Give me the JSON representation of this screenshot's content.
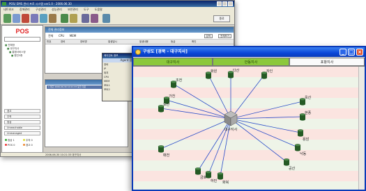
{
  "back_window": {
    "title": "POS/ EMS 관리 프로 시스템 ver1.0 - 2006.06.30",
    "menu": [
      "네트워크",
      "장애관리",
      "구성관리",
      "성능관리",
      "보안관리",
      "도구",
      "도움말"
    ],
    "exit_label": "종료",
    "logo": "POS",
    "tree": [
      "전체망",
      "대구지사",
      "통합서비스망",
      "원천3층"
    ],
    "status_rows": [
      "경고",
      "주의",
      "정상",
      "Unreachable",
      "Unmanaged"
    ],
    "legend": [
      {
        "label": "정상 1",
        "color": "#3a3"
      },
      {
        "label": "주의 0",
        "color": "#dd3"
      },
      {
        "label": "POS 0",
        "color": "#e33"
      },
      {
        "label": "경고 0",
        "color": "#e83"
      }
    ],
    "main_panel": {
      "title": "전체 관리정보",
      "filter_labels": [
        "전체",
        "CPU",
        "MEM"
      ],
      "buttons": [
        "검색",
        "전체보기"
      ],
      "columns": [
        "번호",
        "장비",
        "장비명",
        "발생일시",
        "발생내용",
        "등급",
        "확인"
      ]
    },
    "alarm_panel": {
      "rows": [
        "1  대구  2006-06-30 10:21:33  링크 다운"
      ]
    },
    "agent_popup": {
      "title": "에이전트 정보",
      "header": "Agent 정보",
      "labels": [
        "장비",
        "IP",
        "위치",
        "CPU",
        "MEM",
        "포트1",
        "포트2"
      ]
    },
    "statusbar": "2006-06-30  10:21:33  대구지사"
  },
  "front_window": {
    "title": "구성도 [경북 - 대구지사]",
    "tabs": [
      "대구지사",
      "안동지사",
      "포항지사"
    ],
    "center_label": "대구지사",
    "nodes": [
      {
        "id": "jojeon",
        "label": "조전"
      },
      {
        "id": "hwawon",
        "label": "화원"
      },
      {
        "id": "dasan",
        "label": "다산"
      },
      {
        "id": "jain",
        "label": "자인"
      },
      {
        "id": "gacheon",
        "label": "가천"
      },
      {
        "id": "dosan",
        "label": "도산"
      },
      {
        "id": "oksan",
        "label": "옥산"
      },
      {
        "id": "hyeonpung",
        "label": "현풍"
      },
      {
        "id": "yongam",
        "label": "용암"
      },
      {
        "id": "nakdong",
        "label": "낙동"
      },
      {
        "id": "gongsan",
        "label": "공산"
      },
      {
        "id": "maejeon",
        "label": "매전"
      },
      {
        "id": "geumho",
        "label": "금호"
      },
      {
        "id": "habin",
        "label": "하빈"
      },
      {
        "id": "hwabuk",
        "label": "화북"
      }
    ],
    "colors": {
      "link": "#2a4cc8",
      "node_top": "#4a8a4a",
      "node_body": "#245a24",
      "tab_active": "#8cc83c"
    }
  }
}
